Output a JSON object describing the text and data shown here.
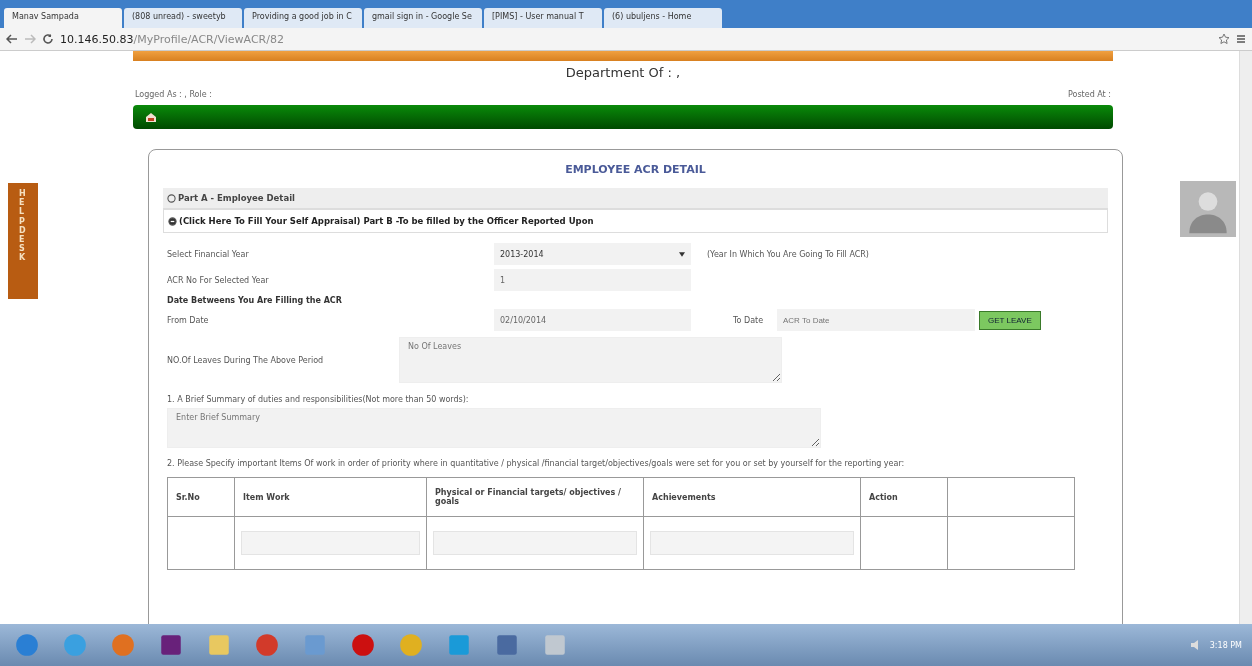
{
  "browser": {
    "tabs": [
      {
        "label": "Manav Sampada",
        "selected": true
      },
      {
        "label": "(808 unread) - sweetyb",
        "selected": false
      },
      {
        "label": "Providing a good job in C",
        "selected": false
      },
      {
        "label": "gmail sign in - Google Se",
        "selected": false
      },
      {
        "label": "[PIMS] - User manual T",
        "selected": false
      },
      {
        "label": "(6) ubuljens - Home",
        "selected": false
      }
    ],
    "url_host": "10.146.50.83",
    "url_path": "/MyProfile/ACR/ViewACR/82"
  },
  "header": {
    "department": "Department Of : ,",
    "logged_as": "Logged As : , Role :",
    "posted_at": "Posted At :"
  },
  "help_desk": "HELP DESK",
  "card": {
    "title": "EMPLOYEE ACR DETAIL",
    "sections": [
      {
        "label": "Part A - Employee Detail",
        "expanded": false
      },
      {
        "label": "(Click Here To Fill Your Self Appraisal) Part B -To be filled by the Officer Reported Upon",
        "expanded": true
      }
    ],
    "rows": [
      {
        "kind": "select",
        "label": "Select Financial Year",
        "value": "2013-2014",
        "note": "(Year In Which You Are Going To Fill ACR)"
      },
      {
        "kind": "input",
        "label": "ACR No For Selected Year",
        "value": "1"
      },
      {
        "kind": "heading",
        "label": "Date Betweens You Are Filling the ACR"
      },
      {
        "kind": "dates",
        "label": "From Date",
        "value": "02/10/2014",
        "to_label": "To Date",
        "to_placeholder": "ACR To Date",
        "button": "GET LEAVE"
      },
      {
        "kind": "textarea",
        "label": "NO.Of Leaves During The Above Period",
        "placeholder": "No Of Leaves"
      }
    ],
    "question_1": {
      "label": "1. A Brief Summary of duties and responsibilities(Not more than 50 words):",
      "placeholder": "Enter Brief Summary"
    },
    "question_2": "2. Please Specify important Items Of work in order of priority where in quantitative / physical /financial target/objectives/goals were set for you or set by yourself for the reporting year:",
    "table": {
      "columns": [
        "Sr.No",
        "Item Work",
        "Physical or Financial targets/ objectives / goals",
        "Achievements",
        "Action"
      ]
    }
  },
  "taskbar": {
    "clock": "3:18 PM"
  }
}
